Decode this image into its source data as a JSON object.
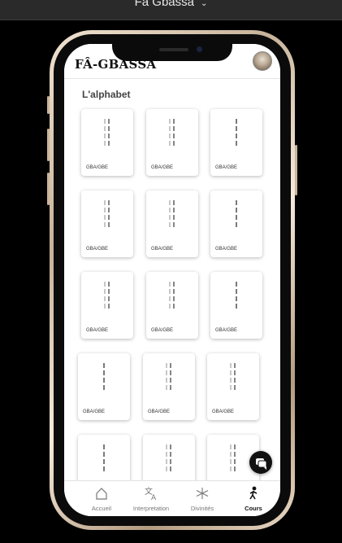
{
  "window": {
    "title": "Fâ Gbassa"
  },
  "app": {
    "title": "FÂ-GBASSA"
  },
  "section": {
    "title": "L'alphabet"
  },
  "cards": [
    {
      "label": "GBA/GBE",
      "marks": [
        [
          2,
          2
        ],
        [
          2,
          2
        ],
        [
          2,
          2
        ],
        [
          2,
          2
        ]
      ]
    },
    {
      "label": "GBA/GBE",
      "marks": [
        [
          2,
          2
        ],
        [
          2,
          2
        ],
        [
          2,
          2
        ],
        [
          2,
          2
        ]
      ]
    },
    {
      "label": "GBA/GBE",
      "marks": [
        [
          1
        ],
        [
          1
        ],
        [
          1
        ],
        [
          1
        ]
      ]
    },
    {
      "label": "GBA/GBE",
      "marks": [
        [
          2,
          2
        ],
        [
          2,
          2
        ],
        [
          2,
          2
        ],
        [
          2,
          2
        ]
      ]
    },
    {
      "label": "GBA/GBE",
      "marks": [
        [
          2,
          2
        ],
        [
          2,
          2
        ],
        [
          2,
          2
        ],
        [
          2,
          2
        ]
      ]
    },
    {
      "label": "GBA/GBE",
      "marks": [
        [
          1
        ],
        [
          1
        ],
        [
          1
        ],
        [
          1
        ]
      ]
    },
    {
      "label": "GBA/GBE",
      "marks": [
        [
          2,
          2
        ],
        [
          2,
          2
        ],
        [
          2,
          2
        ],
        [
          2,
          2
        ]
      ]
    },
    {
      "label": "GBA/GBE",
      "marks": [
        [
          2,
          2
        ],
        [
          2,
          2
        ],
        [
          2,
          2
        ],
        [
          2,
          2
        ]
      ]
    },
    {
      "label": "GBA/GBE",
      "marks": [
        [
          1
        ],
        [
          1
        ],
        [
          1
        ],
        [
          1
        ]
      ]
    },
    {
      "label": "GBA/GBE",
      "marks": [
        [
          1
        ],
        [
          1
        ],
        [
          1
        ],
        [
          1
        ]
      ]
    },
    {
      "label": "GBA/GBE",
      "marks": [
        [
          2,
          2
        ],
        [
          2,
          2
        ],
        [
          2,
          2
        ],
        [
          2,
          2
        ]
      ]
    },
    {
      "label": "GBA/GBE",
      "marks": [
        [
          2,
          2
        ],
        [
          2,
          2
        ],
        [
          2,
          2
        ],
        [
          2,
          2
        ]
      ]
    },
    {
      "label": "",
      "marks": [
        [
          1
        ],
        [
          1
        ],
        [
          1
        ],
        [
          1
        ]
      ]
    },
    {
      "label": "",
      "marks": [
        [
          2,
          2
        ],
        [
          2,
          2
        ],
        [
          2,
          2
        ],
        [
          2,
          2
        ]
      ]
    },
    {
      "label": "",
      "marks": [
        [
          2,
          2
        ],
        [
          2,
          2
        ],
        [
          2,
          2
        ],
        [
          2,
          2
        ]
      ]
    }
  ],
  "fab": {
    "icon": "chat-icon"
  },
  "nav": [
    {
      "label": "Accueil",
      "icon": "home-icon",
      "active": false
    },
    {
      "label": "Interpretation",
      "icon": "translate-icon",
      "active": false
    },
    {
      "label": "Divinités",
      "icon": "snowflake-icon",
      "active": false
    },
    {
      "label": "Cours",
      "icon": "walking-person-icon",
      "active": true
    }
  ],
  "colors": {
    "accent": "#111111",
    "muted": "#777777"
  }
}
